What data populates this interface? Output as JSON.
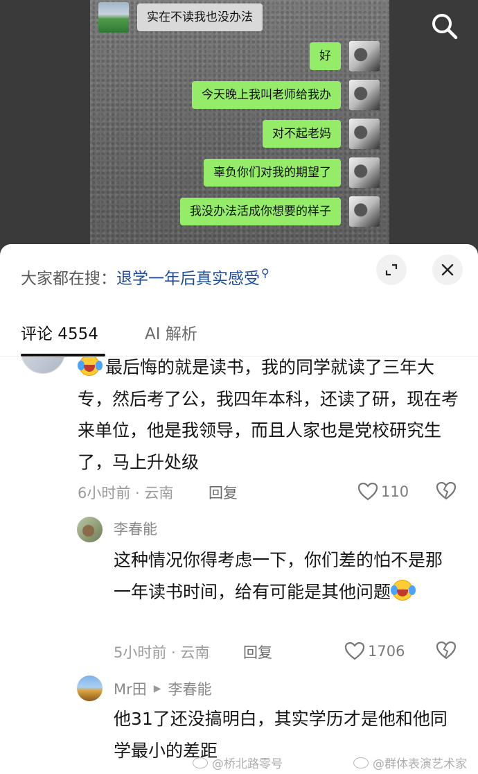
{
  "video": {
    "messages": [
      {
        "side": "left",
        "text": "实在不读我也没办法"
      },
      {
        "side": "right",
        "text": "好"
      },
      {
        "side": "right",
        "text": "今天晚上我叫老师给我办"
      },
      {
        "side": "right",
        "text": "对不起老妈"
      },
      {
        "side": "right",
        "text": "辜负你们对我的期望了"
      },
      {
        "side": "right",
        "text": "我没办法活成你想要的样子"
      }
    ],
    "search_icon": "search-icon"
  },
  "hot_search": {
    "prefix": "大家都在搜：",
    "link": "退学一年后真实感受",
    "link_icon": "search-icon"
  },
  "tabs": {
    "comments": "评论 4554",
    "ai": "AI 解析"
  },
  "comments": [
    {
      "emoji": "crying-laughing-emoji",
      "text": "最后悔的就是读书，我的同学就读了三年大专，然后考了公，我四年本科，还读了研，现在考来单位，他是我领导，而且人家也是党校研究生了，马上升处级",
      "meta": "6小时前 · 云南",
      "reply": "回复",
      "likes": "110"
    },
    {
      "author": "李春能",
      "text": "这种情况你得考虑一下，你们差的怕不是那一年读书时间，给有可能是其他问题",
      "emoji": "crying-laughing-emoji",
      "meta": "5小时前 · 云南",
      "reply": "回复",
      "likes": "1706"
    },
    {
      "author": "Mr田",
      "reply_to": "李春能",
      "text": "他31了还没搞明白，其实学历才是他和他同学最小的差距"
    }
  ],
  "watermarks": [
    "@桥北路零号",
    "@群体表演艺术家"
  ]
}
